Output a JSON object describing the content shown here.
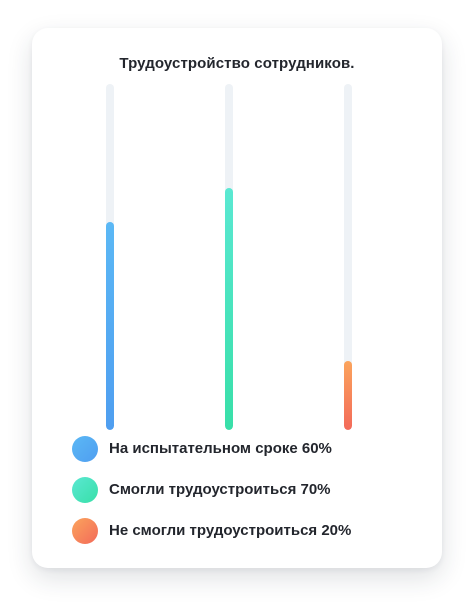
{
  "chart_data": {
    "type": "bar",
    "title": "Трудоустройство сотрудников.",
    "categories": [
      "На испытательном сроке",
      "Смогли трудоустроиться",
      "Не смогли трудоустроиться"
    ],
    "values": [
      60,
      70,
      20
    ],
    "ylim": [
      0,
      100
    ],
    "unit": "%",
    "orientation": "vertical",
    "grid": false,
    "legend_position": "bottom-left",
    "legend": [
      {
        "label": "На испытательном сроке 60%",
        "color_top": "#5bb8f5",
        "color_bottom": "#4f9ef0"
      },
      {
        "label": "Смогли трудоустроиться 70%",
        "color_top": "#5ae8d2",
        "color_bottom": "#38dfa8"
      },
      {
        "label": "Не смогли трудоустроиться 20%",
        "color_top": "#fba45c",
        "color_bottom": "#f36a5a"
      }
    ]
  },
  "colors": {
    "track": "#eef2f6",
    "card_background": "#ffffff",
    "text": "#23262d"
  }
}
